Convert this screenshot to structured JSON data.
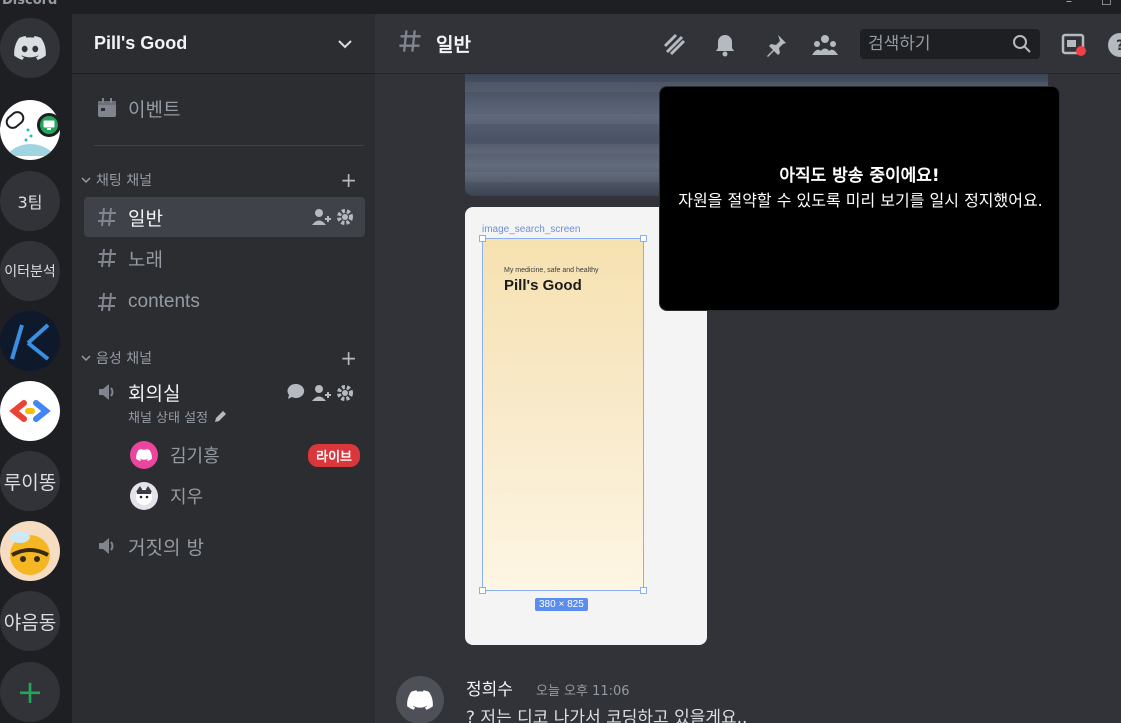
{
  "app": {
    "brand": "Discord"
  },
  "servers": [
    {
      "name": "direct-messages",
      "label": ""
    },
    {
      "name": "server-pill",
      "label": ""
    },
    {
      "name": "server-3team",
      "label": "3팀"
    },
    {
      "name": "server-data-analysis",
      "label": "이터분석"
    },
    {
      "name": "server-k",
      "label": ""
    },
    {
      "name": "server-dev",
      "label": ""
    },
    {
      "name": "server-ruittong",
      "label": "루이똥"
    },
    {
      "name": "server-bee",
      "label": ""
    },
    {
      "name": "server-ya",
      "label": "야음동"
    },
    {
      "name": "add-server",
      "label": "+"
    }
  ],
  "sidebar": {
    "server_name": "Pill's Good",
    "events_label": "이벤트",
    "text_category": "채팅 채널",
    "voice_category": "음성 채널",
    "text_channels": [
      {
        "label": "일반",
        "active": true
      },
      {
        "label": "노래",
        "active": false
      },
      {
        "label": "contents",
        "active": false
      }
    ],
    "voice_channels": [
      {
        "label": "회의실",
        "status": "채널 상태 설정"
      },
      {
        "label": "거짓의 방"
      }
    ],
    "voice_users": [
      {
        "name": "김기흥",
        "live": "라이브"
      },
      {
        "name": "지우"
      }
    ]
  },
  "header": {
    "channel_name": "일반",
    "search_placeholder": "검색하기"
  },
  "attachment": {
    "frame_label": "image_search_screen",
    "app_subtitle": "My medicine, safe and healthy",
    "app_title": "Pill's Good",
    "dimensions": "380 × 825"
  },
  "popup": {
    "title": "아직도 방송 중이에요!",
    "body": "자원을 절약할 수 있도록 미리 보기를 일시 정지했어요."
  },
  "message": {
    "author": "정희수",
    "time": "오늘 오후 11:06",
    "text": "? 저는 디코 나가서 코딩하고 있을게요.."
  },
  "colors": {
    "accent": "#5865f2",
    "live": "#da373c",
    "online": "#23a55a"
  }
}
